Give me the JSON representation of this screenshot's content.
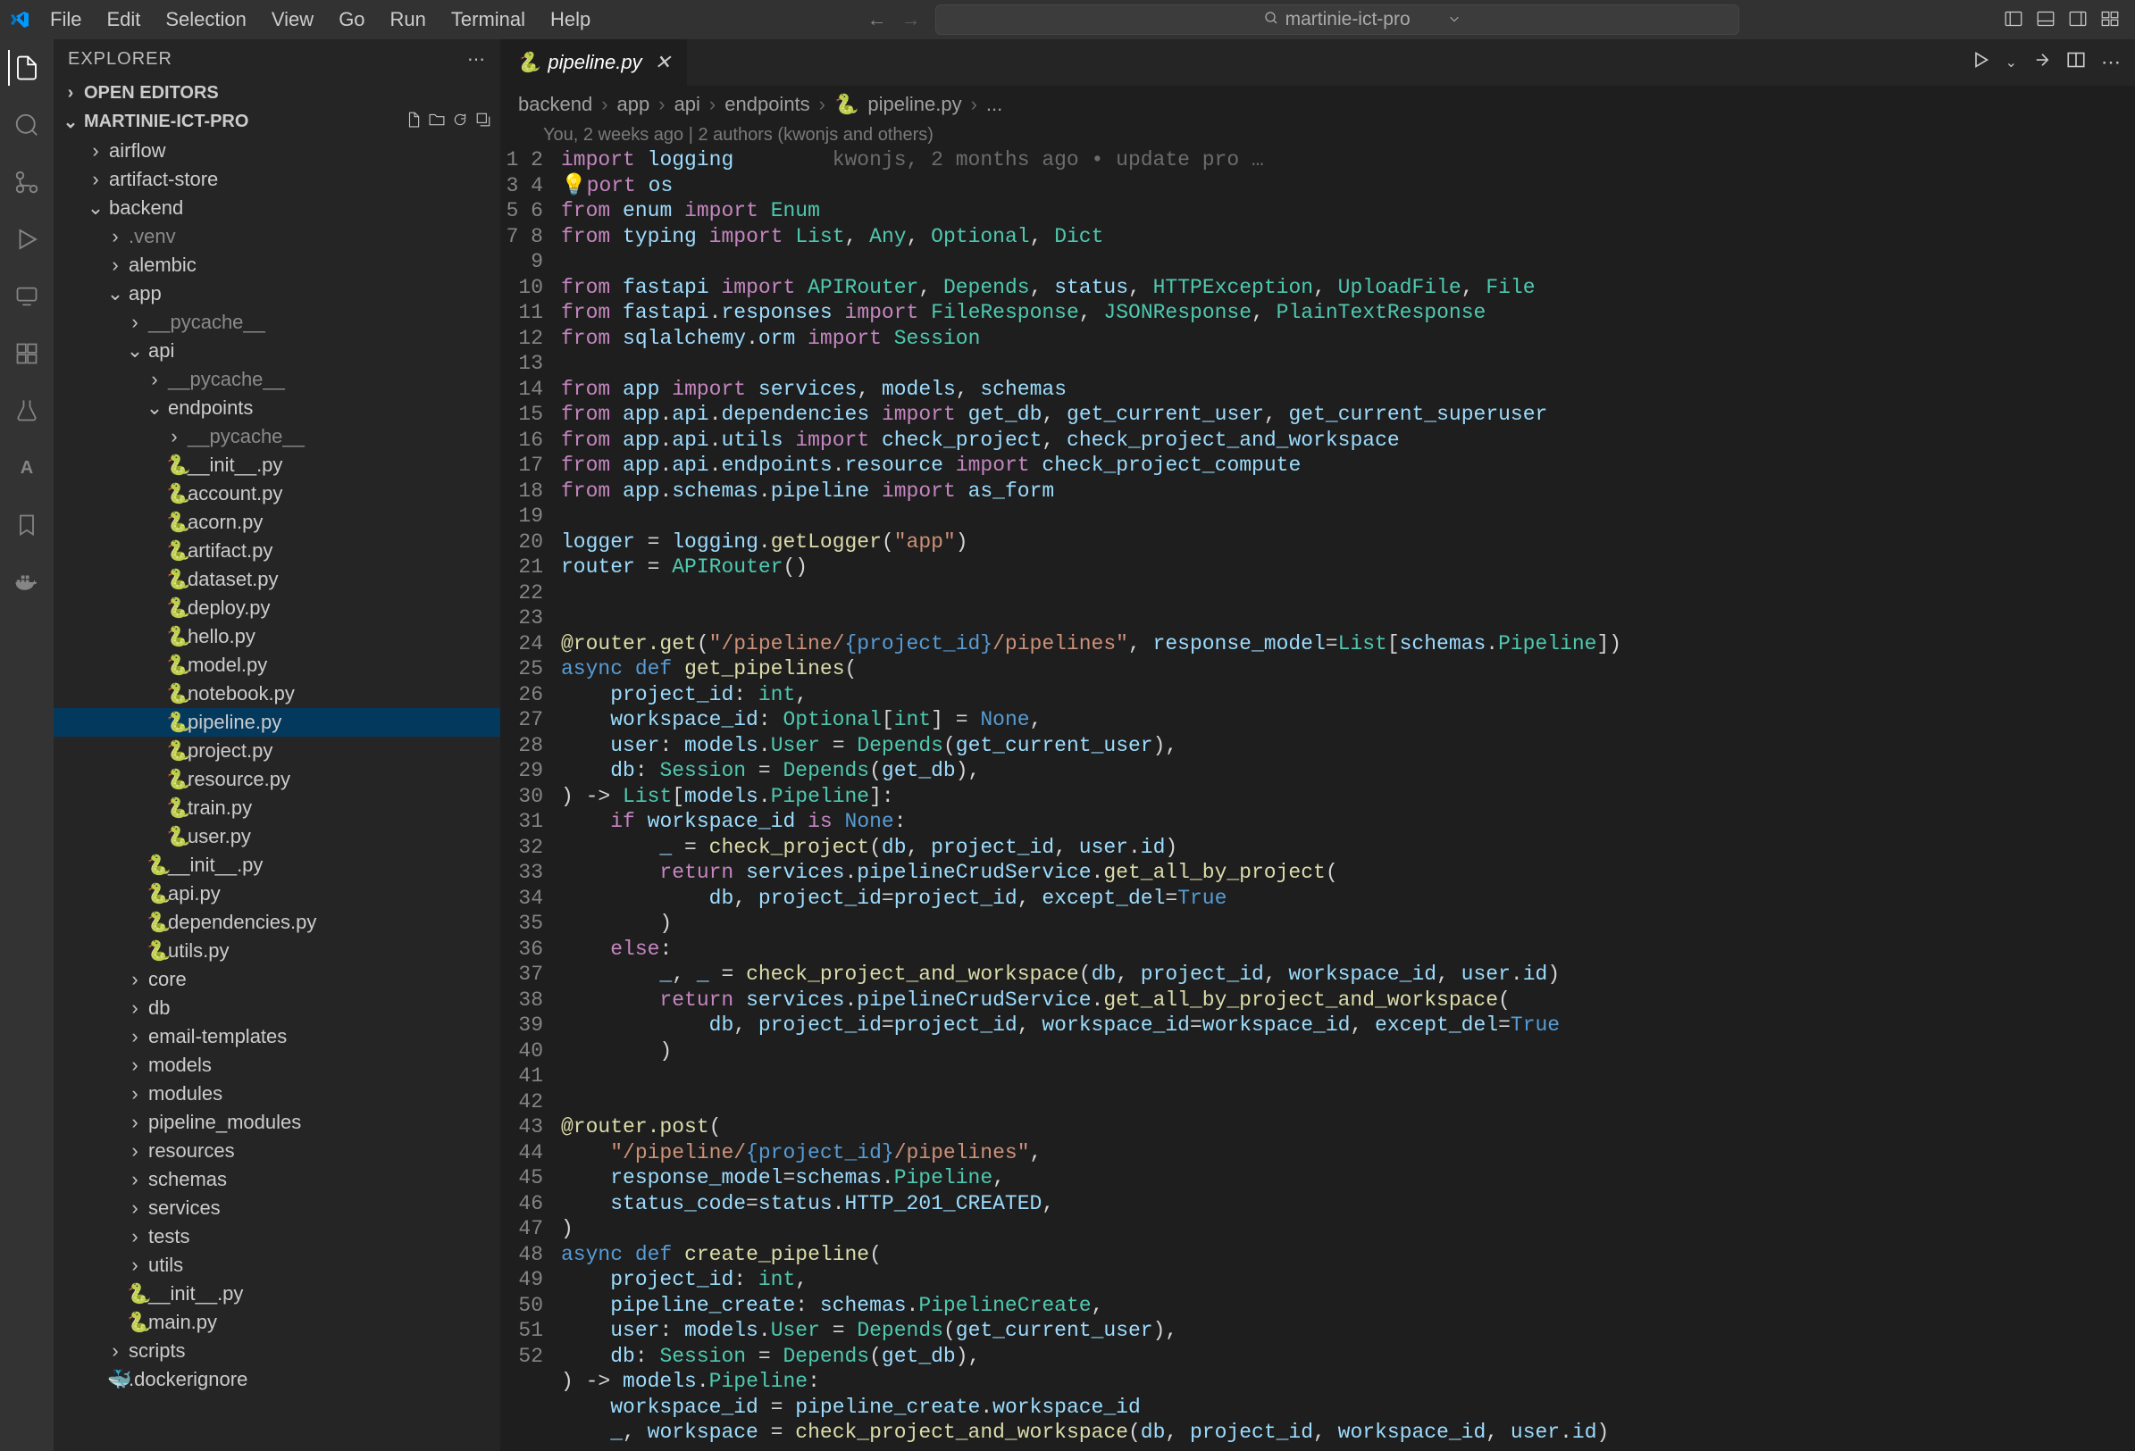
{
  "menu": [
    "File",
    "Edit",
    "Selection",
    "View",
    "Go",
    "Run",
    "Terminal",
    "Help"
  ],
  "search": {
    "text": "martinie-ict-pro"
  },
  "sidebar": {
    "title": "EXPLORER",
    "openEditors": "OPEN EDITORS",
    "project": "MARTINIE-ICT-PRO",
    "tree": {
      "airflow": "airflow",
      "artifactStore": "artifact-store",
      "backend": "backend",
      "venv": ".venv",
      "alembic": "alembic",
      "app": "app",
      "pycache1": "__pycache__",
      "api": "api",
      "pycache2": "__pycache__",
      "endpoints": "endpoints",
      "pycache3": "__pycache__",
      "files": {
        "init": "__init__.py",
        "account": "account.py",
        "acorn": "acorn.py",
        "artifact": "artifact.py",
        "dataset": "dataset.py",
        "deploy": "deploy.py",
        "hello": "hello.py",
        "model": "model.py",
        "notebook": "notebook.py",
        "pipeline": "pipeline.py",
        "project": "project.py",
        "resource": "resource.py",
        "train": "train.py",
        "user": "user.py"
      },
      "apiInit": "__init__.py",
      "apiFile": "api.py",
      "dependencies": "dependencies.py",
      "utils": "utils.py",
      "core": "core",
      "db": "db",
      "emailTemplates": "email-templates",
      "models": "models",
      "modules": "modules",
      "pipelineModules": "pipeline_modules",
      "resources": "resources",
      "schemas": "schemas",
      "services": "services",
      "tests": "tests",
      "utilsFolder": "utils",
      "appInit": "__init__.py",
      "main": "main.py",
      "scripts": "scripts",
      "dockerignore": ".dockerignore"
    }
  },
  "tab": {
    "name": "pipeline.py"
  },
  "breadcrumb": [
    "backend",
    "app",
    "api",
    "endpoints",
    "pipeline.py",
    "..."
  ],
  "authors": "You, 2 weeks ago | 2 authors (kwonjs and others)",
  "blame": "kwonjs, 2 months ago • update pro …",
  "code": {
    "lines": 52
  }
}
